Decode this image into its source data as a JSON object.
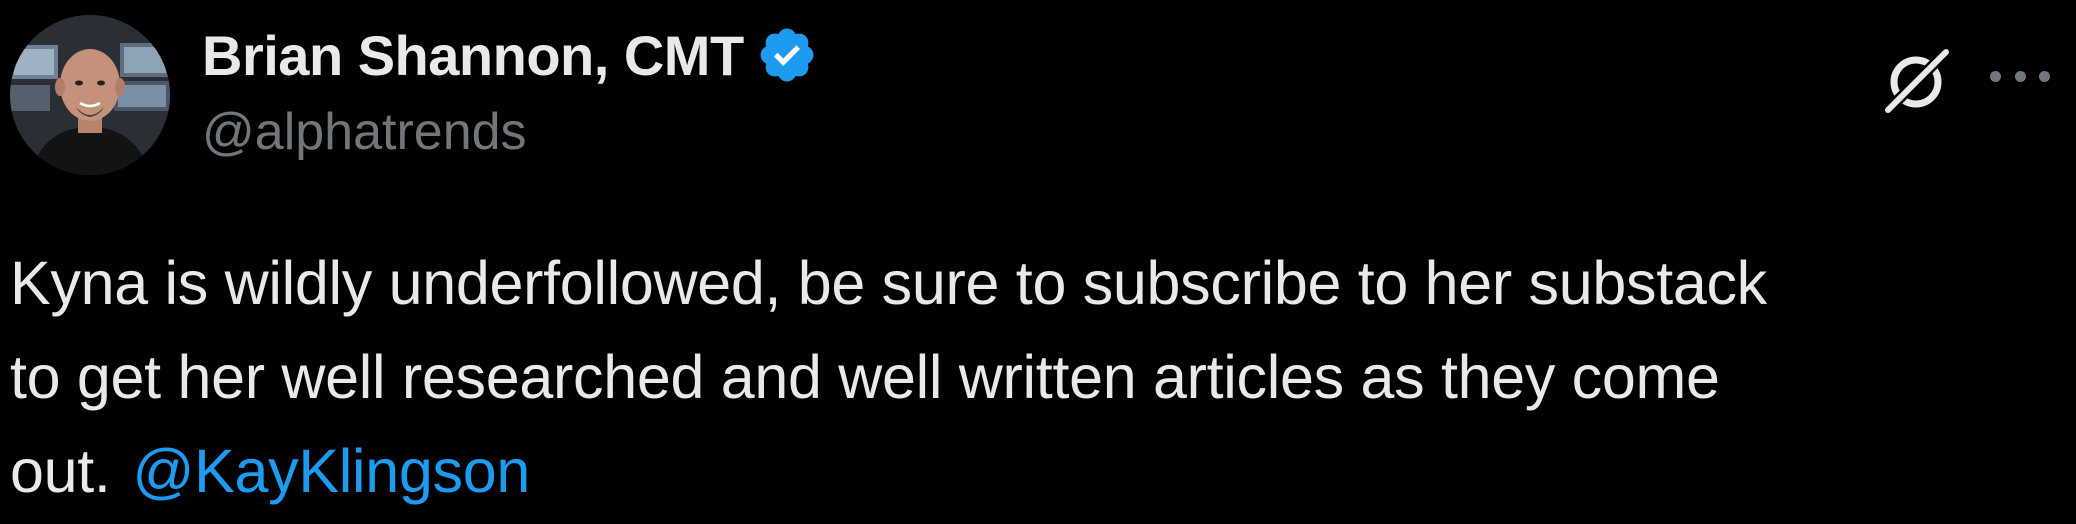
{
  "author": {
    "display_name": "Brian Shannon, CMT",
    "handle": "@alphatrends",
    "verified": true,
    "avatar_icon": "avatar-photo"
  },
  "actions": {
    "grok_icon": "grok-icon",
    "more_icon": "more-dots-icon"
  },
  "tweet": {
    "line1": "Kyna is wildly underfollowed, be sure to subscribe to her substack",
    "line2": "to get her well researched and well written articles as they come",
    "line3": "out.",
    "mention": "@KayKlingson"
  },
  "colors": {
    "background": "#000000",
    "text_primary": "#e7e9ea",
    "text_secondary": "#71767b",
    "link": "#1d9bf0",
    "verified_badge": "#1d9bf0"
  }
}
